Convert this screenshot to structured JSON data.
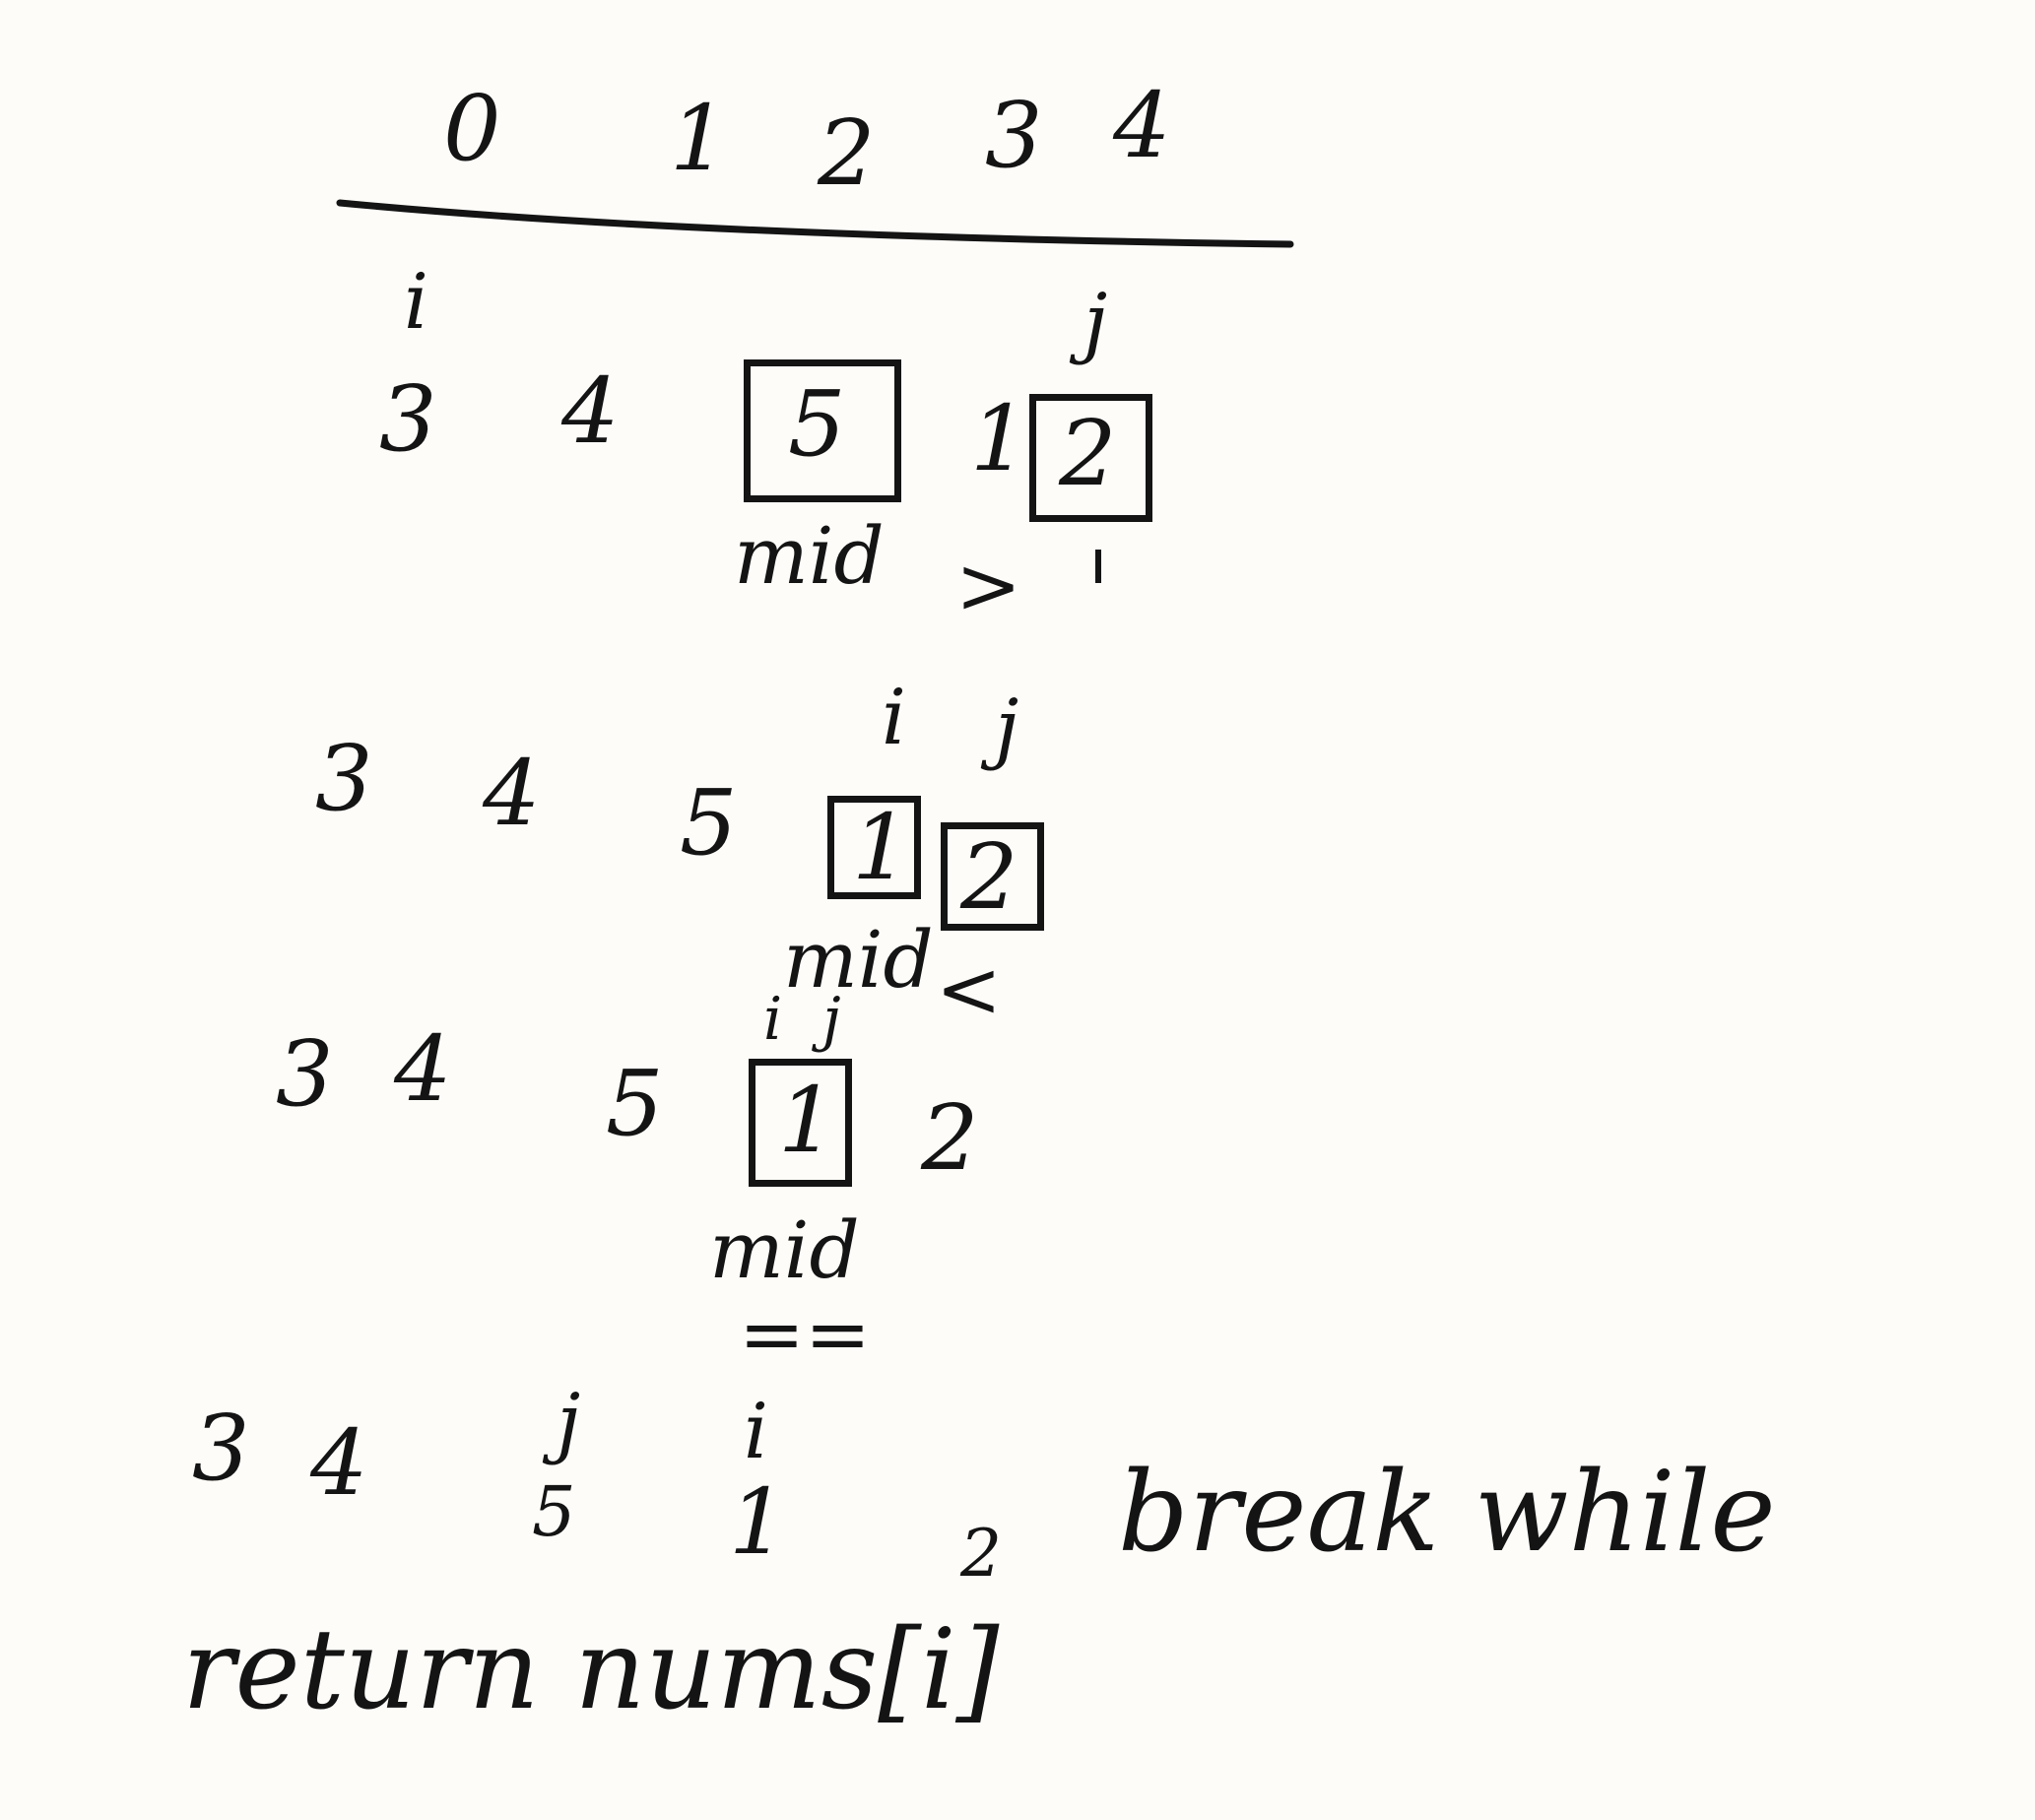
{
  "indices": [
    "0",
    "1",
    "2",
    "3",
    "4"
  ],
  "rows": [
    {
      "values": [
        "3",
        "4",
        "5",
        "1",
        "2"
      ],
      "pointers": [
        {
          "label": "i",
          "at": 0
        },
        {
          "label": "j",
          "at": 4
        }
      ],
      "boxed": [
        2,
        4
      ],
      "mid_label": "mid",
      "compare": ">"
    },
    {
      "values": [
        "3",
        "4",
        "5",
        "1",
        "2"
      ],
      "pointers": [
        {
          "label": "i",
          "at": 3
        },
        {
          "label": "j",
          "at": 4
        }
      ],
      "boxed": [
        3,
        4
      ],
      "mid_label": "mid",
      "compare": "<"
    },
    {
      "values": [
        "3",
        "4",
        "5",
        "1",
        "2"
      ],
      "pointers": [
        {
          "label": "i",
          "at": 3
        },
        {
          "label": "j",
          "at": 3
        }
      ],
      "boxed": [
        3
      ],
      "mid_label": "mid",
      "compare": "=="
    },
    {
      "values": [
        "3",
        "4",
        "5",
        "1",
        "2"
      ],
      "pointers": [
        {
          "label": "j",
          "at": 2
        },
        {
          "label": "i",
          "at": 3
        }
      ],
      "boxed": [],
      "note": "break while"
    }
  ],
  "result": "return nums[i]"
}
